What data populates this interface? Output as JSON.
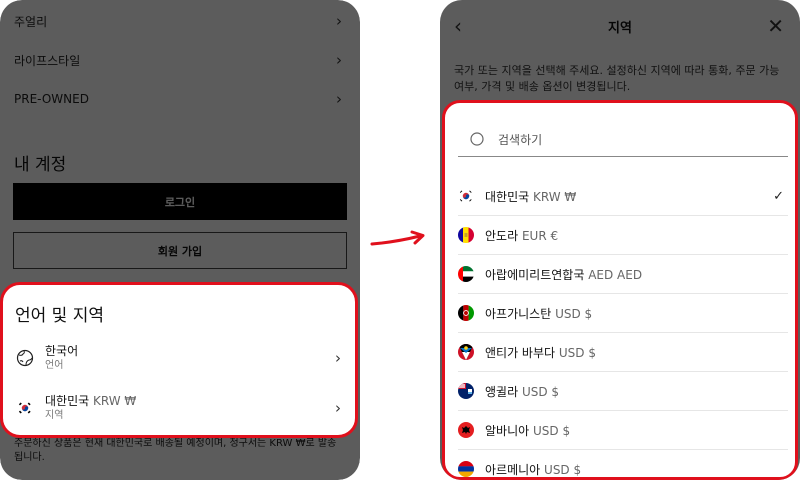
{
  "left": {
    "menu_items": [
      {
        "label": "주얼리"
      },
      {
        "label": "라이프스타일"
      },
      {
        "label": "PRE-OWNED"
      }
    ],
    "account_title": "내 계정",
    "login_label": "로그인",
    "signup_label": "회원 가입",
    "lang_region": {
      "title": "언어 및 지역",
      "language": {
        "value": "한국어",
        "sublabel": "언어",
        "icon": "globe-icon"
      },
      "region": {
        "value": "대한민국",
        "currency": "KRW ₩",
        "sublabel": "지역",
        "icon": "flag-kr-icon"
      }
    },
    "bottom_note": "주문하신 상품은 현재 대한민국로 배송될 예정이며, 청구서는 KRW ₩로 발송됩니다."
  },
  "right": {
    "title": "지역",
    "description": "국가 또는 지역을 선택해 주세요. 설정하신 지역에 따라 통화, 주문 가능 여부, 가격 및 배송 옵션이 변경됩니다.",
    "search_placeholder": "검색하기",
    "countries": [
      {
        "name": "대한민국",
        "currency": "KRW ₩",
        "selected": true,
        "flag": "kr"
      },
      {
        "name": "안도라",
        "currency": "EUR €",
        "selected": false,
        "flag": "ad"
      },
      {
        "name": "아랍에미리트연합국",
        "currency": "AED AED",
        "selected": false,
        "flag": "ae"
      },
      {
        "name": "아프가니스탄",
        "currency": "USD $",
        "selected": false,
        "flag": "af"
      },
      {
        "name": "앤티가 바부다",
        "currency": "USD $",
        "selected": false,
        "flag": "ag"
      },
      {
        "name": "앵귈라",
        "currency": "USD $",
        "selected": false,
        "flag": "ai"
      },
      {
        "name": "알바니아",
        "currency": "USD $",
        "selected": false,
        "flag": "al"
      },
      {
        "name": "아르메니아",
        "currency": "USD $",
        "selected": false,
        "flag": "am"
      }
    ]
  },
  "colors": {
    "highlight": "#e0101c",
    "overlay": "rgba(0,0,0,0.64)",
    "button_dark": "#000000"
  }
}
